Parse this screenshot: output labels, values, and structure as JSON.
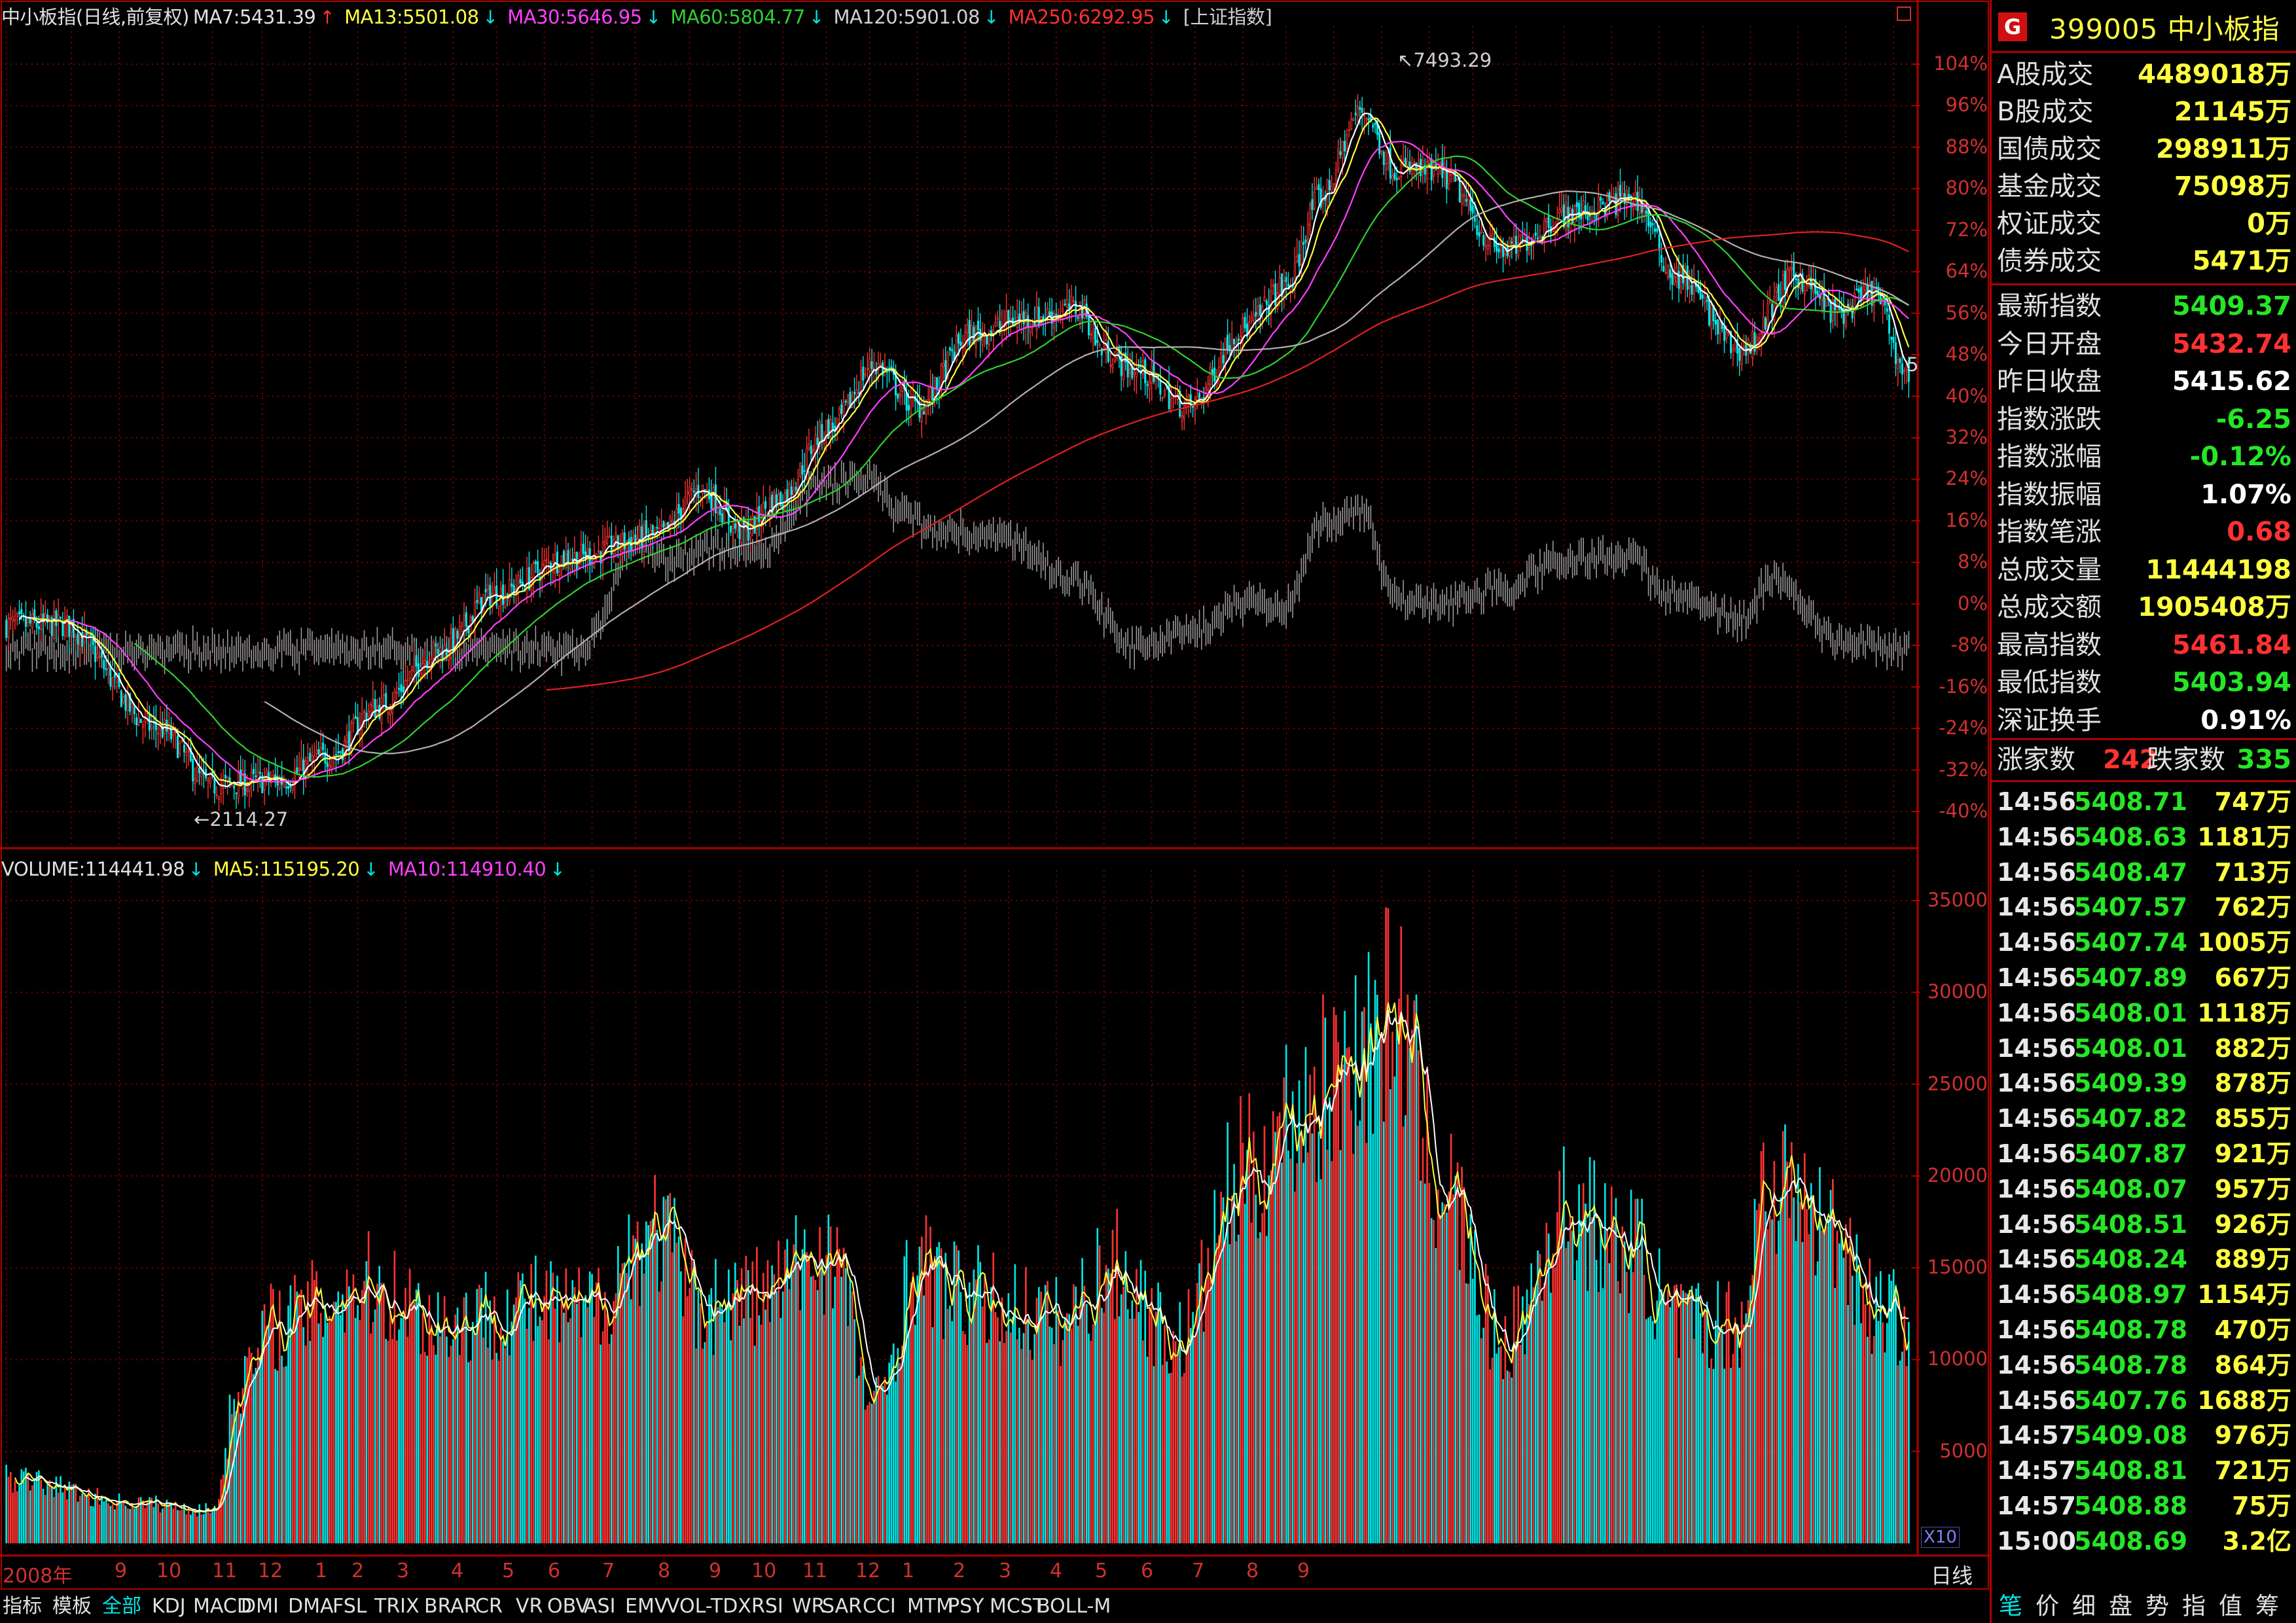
{
  "price_legend": {
    "name": "中小板指(日线,前复权)",
    "ma7": "MA7:5431.39",
    "ma13": "MA13:5501.08",
    "ma30": "MA30:5646.95",
    "ma60": "MA60:5804.77",
    "ma120": "MA120:5901.08",
    "ma250": "MA250:6292.95",
    "overlay": "[上证指数]",
    "ma7_dir": "↑",
    "ma13_dir": "↓",
    "ma30_dir": "↓",
    "ma60_dir": "↓",
    "ma120_dir": "↓",
    "ma250_dir": "↓"
  },
  "volume_legend": {
    "volume": "VOLUME:114441.98",
    "ma5": "MA5:115195.20",
    "ma10": "MA10:114910.40",
    "vol_dir": "↓",
    "ma5_dir": "↓",
    "ma10_dir": "↓"
  },
  "annotations": {
    "high": "7493.29",
    "low": "2114.27",
    "last_mark": "5"
  },
  "colors": {
    "up": "#ff3232",
    "down": "#00e6e6",
    "ma7": "#ffffff",
    "ma13": "#ffff40",
    "ma30": "#ff40ff",
    "ma60": "#30d030",
    "ma120": "#b0b0b0",
    "ma250": "#e02020",
    "grid": "#800000",
    "volume_ma5": "#ffff40",
    "volume_ma10": "#ffffff"
  },
  "chart_data": [
    {
      "type": "candlestick",
      "title": "中小板指(日线,前复权)",
      "y_axis_ticks": [
        "104%",
        "96%",
        "88%",
        "80%",
        "72%",
        "64%",
        "56%",
        "48%",
        "40%",
        "32%",
        "24%",
        "16%",
        "8%",
        "0%",
        "-8%",
        "-16%",
        "-24%",
        "-32%",
        "-40%"
      ],
      "x_axis_ticks": [
        "2008年",
        "9",
        "10",
        "11",
        "12",
        "1",
        "2",
        "3",
        "4",
        "5",
        "6",
        "7",
        "8",
        "9",
        "10",
        "11",
        "12",
        "1",
        "2",
        "3",
        "4",
        "5",
        "6",
        "7",
        "8",
        "9"
      ],
      "ylim": [
        -44,
        107
      ],
      "high": 7493.29,
      "low": 2114.27,
      "anchors_pct": [
        [
          0,
          -4
        ],
        [
          25,
          -4
        ],
        [
          70,
          -24
        ],
        [
          95,
          -35
        ],
        [
          125,
          -34
        ],
        [
          150,
          -29
        ],
        [
          170,
          -20
        ],
        [
          200,
          -9
        ],
        [
          225,
          2
        ],
        [
          260,
          9
        ],
        [
          300,
          13
        ],
        [
          320,
          22
        ],
        [
          340,
          14
        ],
        [
          355,
          20
        ],
        [
          380,
          34
        ],
        [
          400,
          46
        ],
        [
          420,
          38
        ],
        [
          445,
          52
        ],
        [
          470,
          55
        ],
        [
          495,
          57
        ],
        [
          505,
          49
        ],
        [
          520,
          45
        ],
        [
          545,
          38
        ],
        [
          570,
          53
        ],
        [
          590,
          61
        ],
        [
          605,
          78
        ],
        [
          625,
          95
        ],
        [
          640,
          84
        ],
        [
          660,
          83
        ],
        [
          690,
          68
        ],
        [
          720,
          75
        ],
        [
          750,
          78
        ],
        [
          770,
          63
        ],
        [
          800,
          49
        ],
        [
          825,
          63
        ],
        [
          845,
          56
        ],
        [
          860,
          60
        ],
        [
          877,
          44
        ]
      ],
      "overlay_anchors_pct": [
        [
          270,
          -5
        ],
        [
          290,
          12
        ],
        [
          305,
          8
        ],
        [
          325,
          11
        ],
        [
          345,
          9
        ],
        [
          375,
          23
        ],
        [
          400,
          24
        ],
        [
          410,
          18
        ],
        [
          430,
          14
        ],
        [
          460,
          13
        ],
        [
          490,
          5
        ],
        [
          520,
          -8
        ],
        [
          545,
          -6
        ],
        [
          570,
          0
        ],
        [
          590,
          -1
        ],
        [
          605,
          15
        ],
        [
          625,
          18
        ],
        [
          640,
          1
        ],
        [
          660,
          0
        ],
        [
          690,
          3
        ],
        [
          720,
          9
        ],
        [
          750,
          9
        ],
        [
          765,
          2
        ],
        [
          800,
          -3
        ],
        [
          815,
          5
        ],
        [
          845,
          -7
        ],
        [
          877,
          -9
        ]
      ]
    },
    {
      "type": "bar",
      "title": "VOLUME",
      "y_axis_ticks": [
        "35000",
        "30000",
        "25000",
        "20000",
        "15000",
        "10000",
        "5000"
      ],
      "ylim": [
        0,
        37000
      ],
      "volume_anchors": [
        [
          0,
          3500
        ],
        [
          60,
          2200
        ],
        [
          95,
          1800
        ],
        [
          108,
          9000
        ],
        [
          125,
          12000
        ],
        [
          165,
          14000
        ],
        [
          205,
          12000
        ],
        [
          240,
          13000
        ],
        [
          265,
          12500
        ],
        [
          300,
          17000
        ],
        [
          320,
          13000
        ],
        [
          345,
          13500
        ],
        [
          380,
          16000
        ],
        [
          400,
          7500
        ],
        [
          420,
          15000
        ],
        [
          440,
          13500
        ],
        [
          460,
          13000
        ],
        [
          485,
          12000
        ],
        [
          510,
          15000
        ],
        [
          540,
          11000
        ],
        [
          570,
          20000
        ],
        [
          600,
          24000
        ],
        [
          625,
          27000
        ],
        [
          640,
          29000
        ],
        [
          660,
          20000
        ],
        [
          690,
          11000
        ],
        [
          720,
          18000
        ],
        [
          750,
          16000
        ],
        [
          770,
          12000
        ],
        [
          800,
          12000
        ],
        [
          810,
          20000
        ],
        [
          845,
          17000
        ],
        [
          860,
          13000
        ],
        [
          877,
          12000
        ]
      ],
      "last_volume": 114441.98,
      "ma5": 115195.2,
      "ma10": 114910.4
    }
  ],
  "panel": {
    "symbol": "399005 中小板指",
    "badge": "G",
    "stats_a": [
      {
        "label": "A股成交",
        "value": "4489018万",
        "color": "#ffff40"
      },
      {
        "label": "B股成交",
        "value": "21145万",
        "color": "#ffff40"
      },
      {
        "label": "国债成交",
        "value": "298911万",
        "color": "#ffff40"
      },
      {
        "label": "基金成交",
        "value": "75098万",
        "color": "#ffff40"
      },
      {
        "label": "权证成交",
        "value": "0万",
        "color": "#ffff40"
      },
      {
        "label": "债券成交",
        "value": "5471万",
        "color": "#ffff40"
      }
    ],
    "stats_b": [
      {
        "label": "最新指数",
        "value": "5409.37",
        "color": "#26e626"
      },
      {
        "label": "今日开盘",
        "value": "5432.74",
        "color": "#ff3232"
      },
      {
        "label": "昨日收盘",
        "value": "5415.62",
        "color": "#ffffff"
      },
      {
        "label": "指数涨跌",
        "value": "-6.25",
        "color": "#26e626"
      },
      {
        "label": "指数涨幅",
        "value": "-0.12%",
        "color": "#26e626"
      },
      {
        "label": "指数振幅",
        "value": "1.07%",
        "color": "#ffffff"
      },
      {
        "label": "指数笔涨",
        "value": "0.68",
        "color": "#ff3232"
      },
      {
        "label": "总成交量",
        "value": "11444198",
        "color": "#ffff40"
      },
      {
        "label": "总成交额",
        "value": "1905408万",
        "color": "#ffff40"
      },
      {
        "label": "最高指数",
        "value": "5461.84",
        "color": "#ff3232"
      },
      {
        "label": "最低指数",
        "value": "5403.94",
        "color": "#26e626"
      },
      {
        "label": "深证换手",
        "value": "0.91%",
        "color": "#ffffff"
      }
    ],
    "advancers_label": "涨家数",
    "advancers": "242",
    "decliners_label": "跌家数",
    "decliners": "335",
    "ticks": [
      {
        "time": "14:56",
        "price": "5408.71",
        "vol": "747万"
      },
      {
        "time": "14:56",
        "price": "5408.63",
        "vol": "1181万"
      },
      {
        "time": "14:56",
        "price": "5408.47",
        "vol": "713万"
      },
      {
        "time": "14:56",
        "price": "5407.57",
        "vol": "762万"
      },
      {
        "time": "14:56",
        "price": "5407.74",
        "vol": "1005万"
      },
      {
        "time": "14:56",
        "price": "5407.89",
        "vol": "667万"
      },
      {
        "time": "14:56",
        "price": "5408.01",
        "vol": "1118万"
      },
      {
        "time": "14:56",
        "price": "5408.01",
        "vol": "882万"
      },
      {
        "time": "14:56",
        "price": "5409.39",
        "vol": "878万"
      },
      {
        "time": "14:56",
        "price": "5407.82",
        "vol": "855万"
      },
      {
        "time": "14:56",
        "price": "5407.87",
        "vol": "921万"
      },
      {
        "time": "14:56",
        "price": "5408.07",
        "vol": "957万"
      },
      {
        "time": "14:56",
        "price": "5408.51",
        "vol": "926万"
      },
      {
        "time": "14:56",
        "price": "5408.24",
        "vol": "889万"
      },
      {
        "time": "14:56",
        "price": "5408.97",
        "vol": "1154万"
      },
      {
        "time": "14:56",
        "price": "5408.78",
        "vol": "470万"
      },
      {
        "time": "14:56",
        "price": "5408.78",
        "vol": "864万"
      },
      {
        "time": "14:56",
        "price": "5407.76",
        "vol": "1688万"
      },
      {
        "time": "14:57",
        "price": "5409.08",
        "vol": "976万"
      },
      {
        "time": "14:57",
        "price": "5408.81",
        "vol": "721万"
      },
      {
        "time": "14:57",
        "price": "5408.88",
        "vol": "75万"
      },
      {
        "time": "15:00",
        "price": "5408.69",
        "vol": "3.2亿"
      }
    ]
  },
  "bottom_tabs": [
    "指标",
    "模板",
    "全部",
    "KDJ",
    "MACD",
    "DMI",
    "DMA",
    "FSL",
    "TRIX",
    "BRAR",
    "CR",
    "VR",
    "OBV",
    "ASI",
    "EMV",
    "VOL-TDX",
    "RSI",
    "WR",
    "SAR",
    "CCI",
    "MTM",
    "PSY",
    "MCST",
    "BOLL-M"
  ],
  "selected_tab": "全部",
  "period": "日线",
  "x10_label": "X10",
  "right_tabs": [
    "笔",
    "价",
    "细",
    "盘",
    "势",
    "指",
    "值",
    "筹"
  ]
}
